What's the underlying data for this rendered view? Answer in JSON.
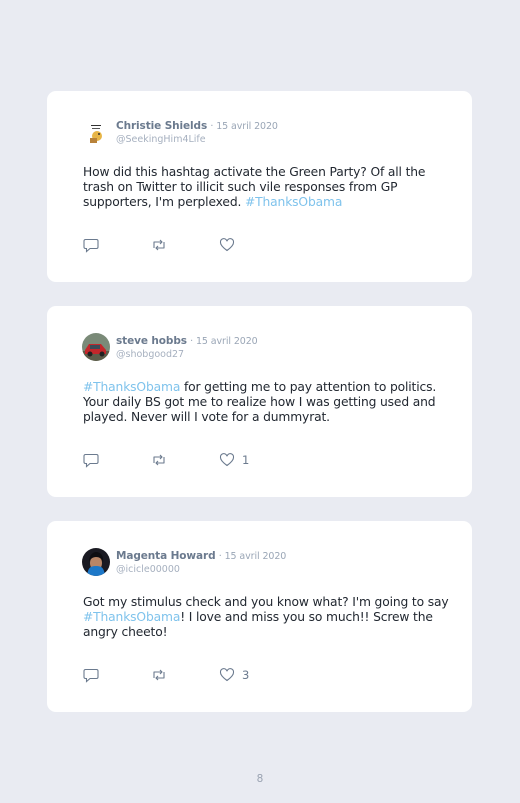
{
  "tweets": [
    {
      "name": "Christie Shields",
      "date": "· 15 avril 2020",
      "handle": "@SeekingHim4Life",
      "text_before": "How did this hashtag activate the Green Party? Of all the trash on Twitter to illicit such vile responses from GP supporters, I'm perplexed. ",
      "hashtag": "#ThanksObama",
      "text_after": "",
      "likes": "",
      "avatar_icon": "cartoon-avatar-icon"
    },
    {
      "name": "steve hobbs",
      "date": "· 15 avril 2020",
      "handle": "@shobgood27",
      "text_before": "",
      "hashtag": "#ThanksObama",
      "text_after": " for getting me to pay attention to politics. Your daily BS got me to realize how I was getting used and played. Never will I vote for a dummyrat.",
      "likes": "1",
      "avatar_icon": "red-car-avatar-icon"
    },
    {
      "name": "Magenta Howard",
      "date": "· 15 avril 2020",
      "handle": "@icicle00000",
      "text_before": "Got my stimulus check and you know what? I'm going to say ",
      "hashtag": "#ThanksObama",
      "text_after": "! I love and miss you so much!! Screw the angry cheeto!",
      "likes": "3",
      "avatar_icon": "portrait-avatar-icon"
    }
  ],
  "page_number": "8",
  "colors": {
    "background": "#e9ebf2",
    "card": "#ffffff",
    "hashtag": "#7fc3ec",
    "name": "#6b7a8e",
    "icon": "#6b7a8e"
  }
}
